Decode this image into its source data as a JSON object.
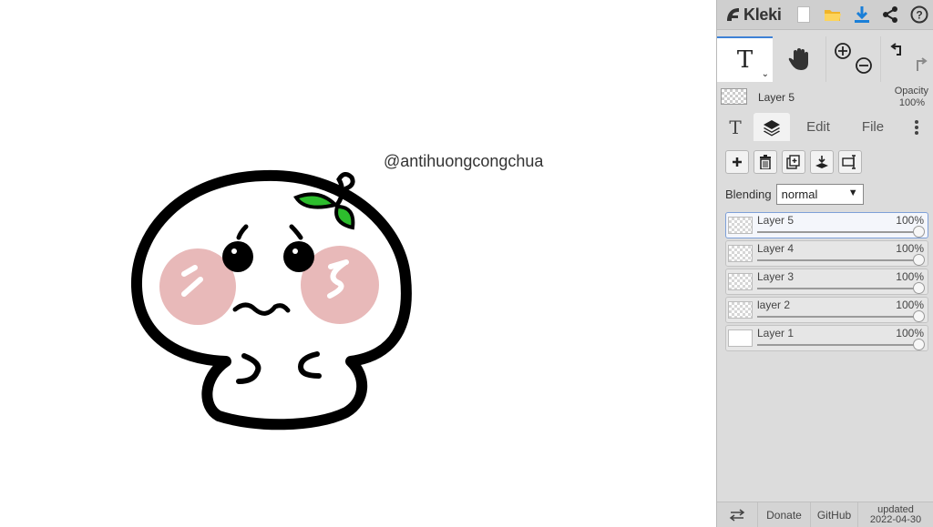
{
  "app": {
    "name": "Kleki"
  },
  "canvas": {
    "watermark": "@antihuongcongchua",
    "colors": {
      "outline": "#000000",
      "blush": "#e8b9b9",
      "leaf": "#2dbd2d",
      "body": "#ffffff"
    }
  },
  "topbar": {
    "icons": [
      "new-file-icon",
      "open-folder-icon",
      "download-icon",
      "share-icon",
      "help-icon"
    ],
    "accent": "#1a7fd8"
  },
  "tools": {
    "text_tool_glyph": "T",
    "icons": [
      "text-tool-icon",
      "hand-tool-icon",
      "zoom-in-icon",
      "zoom-out-icon",
      "undo-icon",
      "redo-icon"
    ]
  },
  "current_layer": {
    "name": "Layer 5",
    "opacity_label": "Opacity",
    "opacity_value": "100%"
  },
  "tabs": {
    "brush_glyph": "T",
    "edit": "Edit",
    "file": "File"
  },
  "layers_panel": {
    "blending_label": "Blending",
    "blending_value": "normal",
    "layers": [
      {
        "name": "Layer 5",
        "opacity": "100%",
        "active": true
      },
      {
        "name": "Layer 4",
        "opacity": "100%",
        "active": false
      },
      {
        "name": "Layer 3",
        "opacity": "100%",
        "active": false
      },
      {
        "name": "layer 2",
        "opacity": "100%",
        "active": false
      },
      {
        "name": "Layer 1",
        "opacity": "100%",
        "active": false
      }
    ]
  },
  "footer": {
    "donate": "Donate",
    "github": "GitHub",
    "updated_label": "updated",
    "updated_date": "2022-04-30"
  }
}
